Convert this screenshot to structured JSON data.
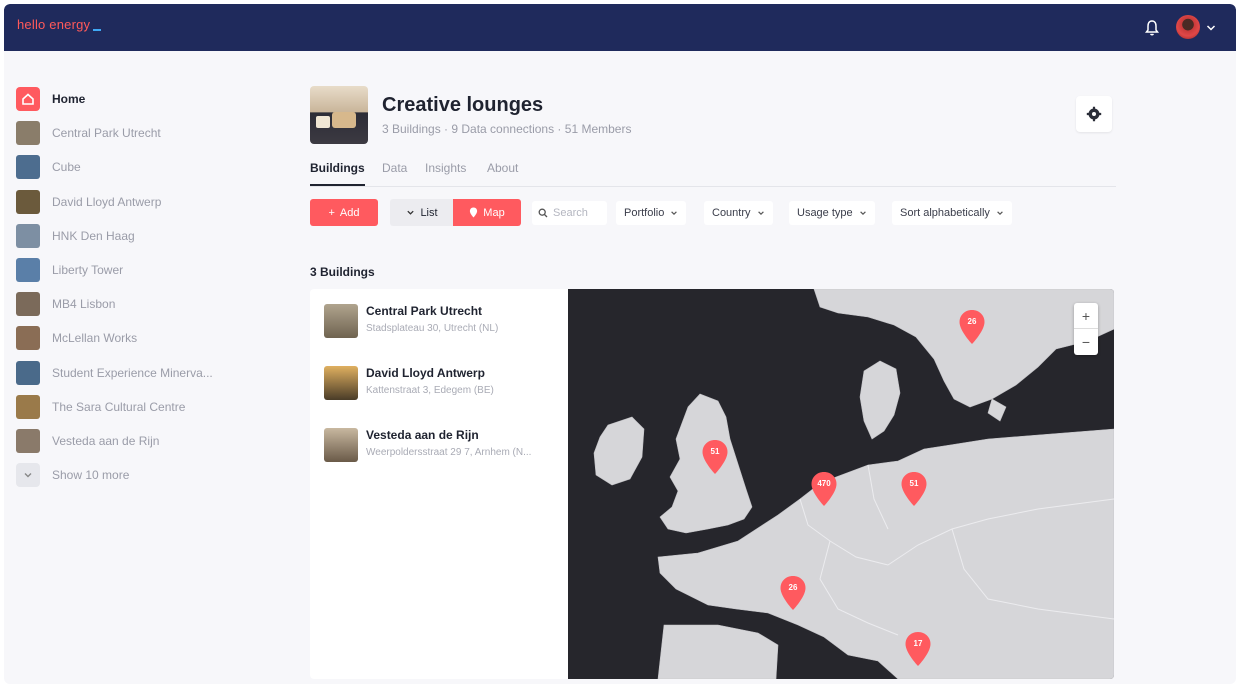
{
  "app": {
    "logo_text": "hello energy"
  },
  "sidebar": {
    "items": [
      {
        "label": "Home",
        "active": true
      },
      {
        "label": "Central Park Utrecht",
        "color": "#8a7d6a"
      },
      {
        "label": "Cube",
        "color": "#4d6d8f"
      },
      {
        "label": "David Lloyd Antwerp",
        "color": "#6b5a3c"
      },
      {
        "label": "HNK Den Haag",
        "color": "#7d8fa3"
      },
      {
        "label": "Liberty Tower",
        "color": "#5a7fa8"
      },
      {
        "label": "MB4 Lisbon",
        "color": "#7b6a5a"
      },
      {
        "label": "McLellan Works",
        "color": "#8a6d55"
      },
      {
        "label": "Student Experience Minerva...",
        "color": "#4a6a8a"
      },
      {
        "label": "The Sara Cultural Centre",
        "color": "#9a7a4a"
      },
      {
        "label": "Vesteda aan de Rijn",
        "color": "#8a7a6a"
      }
    ],
    "show_more_label": "Show 10 more"
  },
  "header": {
    "title": "Creative lounges",
    "subtitle": "3 Buildings · 9 Data connections · 51 Members"
  },
  "tabs": [
    {
      "label": "Buildings",
      "active": true
    },
    {
      "label": "Data"
    },
    {
      "label": "Insights"
    },
    {
      "label": "About"
    }
  ],
  "toolbar": {
    "add_label": "Add",
    "list_label": "List",
    "map_label": "Map",
    "search_placeholder": "Search",
    "filters": [
      "Portfolio",
      "Country",
      "Usage type",
      "Sort alphabetically"
    ]
  },
  "buildings": {
    "count_label": "3 Buildings",
    "items": [
      {
        "name": "Central Park Utrecht",
        "address": "Stadsplateau 30, Utrecht (NL)",
        "color": "#8a7d6a"
      },
      {
        "name": "David Lloyd Antwerp",
        "address": "Kattenstraat 3, Edegem (BE)",
        "color": "#6b5a3c"
      },
      {
        "name": "Vesteda aan de Rijn",
        "address": "Weerpoldersstraat 29 7, Arnhem (N...",
        "color": "#8a7a6a"
      }
    ]
  },
  "map": {
    "zoom_in": "+",
    "zoom_out": "−",
    "pins": [
      {
        "label": "26"
      },
      {
        "label": "51"
      },
      {
        "label": "470"
      },
      {
        "label": "51"
      },
      {
        "label": "26"
      },
      {
        "label": "17"
      }
    ]
  },
  "colors": {
    "brand": "#ff5a5f",
    "topbar": "#1f2a5c",
    "land": "#d6d6d9",
    "water": "#26262c"
  }
}
